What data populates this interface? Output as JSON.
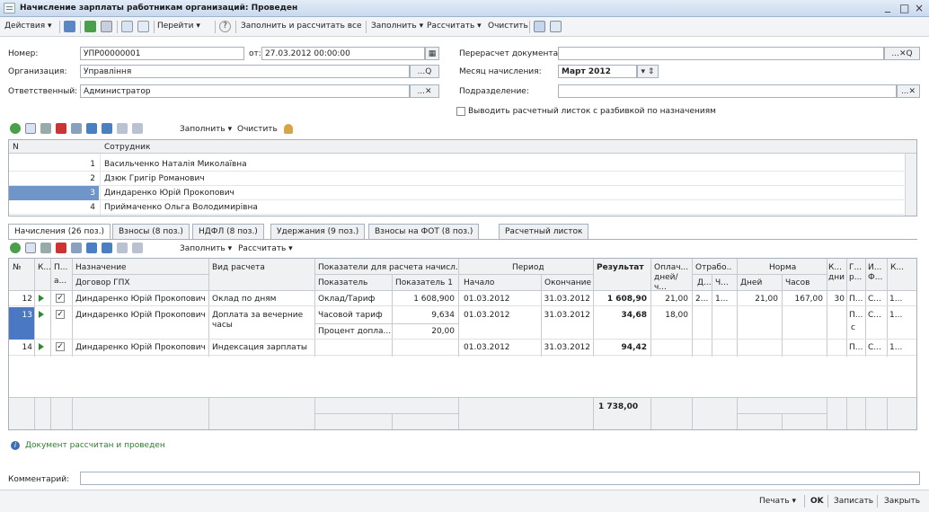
{
  "window": {
    "title": "Начисление зарплаты работникам организаций: Проведен",
    "minimize": "_",
    "maximize": "□",
    "close": "×"
  },
  "toolbar": {
    "actions": "Действия ▾",
    "goto": "Перейти ▾",
    "fill_calc_all": "Заполнить и рассчитать все",
    "fill": "Заполнить ▾",
    "calc": "Рассчитать ▾",
    "clear": "Очистить"
  },
  "header": {
    "number_label": "Номер:",
    "number_value": "УПР00000001",
    "date_label": "от:",
    "date_value": "27.03.2012 00:00:00",
    "org_label": "Организация:",
    "org_value": "Управління",
    "resp_label": "Ответственный:",
    "resp_value": "Администратор",
    "recalc_label": "Перерасчет документа:",
    "recalc_value": "",
    "month_label": "Месяц начисления:",
    "month_value": "Март 2012",
    "dept_label": "Подразделение:",
    "dept_value": "",
    "payslip_checkbox": "Выводить расчетный листок с разбивкой по назначениям"
  },
  "emp_toolbar": {
    "fill": "Заполнить ▾",
    "clear": "Очистить"
  },
  "employees": {
    "col_n": "N",
    "col_name": "Сотрудник",
    "rows": [
      {
        "n": "1",
        "name": "Васильченко Наталія Миколаївна"
      },
      {
        "n": "2",
        "name": "Дзюк Григір Романович"
      },
      {
        "n": "3",
        "name": "Диндаренко Юрій Прокопович"
      },
      {
        "n": "4",
        "name": "Приймаченко Ольга Володимирівна"
      }
    ]
  },
  "tabs": [
    {
      "label": "Начисления (26 поз.)"
    },
    {
      "label": "Взносы (8 поз.)"
    },
    {
      "label": "НДФЛ (8 поз.)"
    },
    {
      "label": "Удержания (9 поз.)"
    },
    {
      "label": "Взносы на ФОТ (8 поз.)"
    },
    {
      "label": "Расчетный листок"
    }
  ],
  "acc_toolbar": {
    "fill": "Заполнить ▾",
    "calc": "Рассчитать ▾"
  },
  "accruals": {
    "h_no": "№",
    "h_k": "К...",
    "h_p": "П...",
    "h_a": "а...",
    "h_assign": "Назначение",
    "h_contract": "Договор ГПХ",
    "h_calc_type": "Вид расчета",
    "h_indicators": "Показатели для расчета начисл...",
    "h_indicator": "Показатель",
    "h_indicator1": "Показатель 1",
    "h_period": "Период",
    "h_start": "Начало",
    "h_end": "Окончание",
    "h_result": "Результат",
    "h_paid": "Оплач... дней/ч...",
    "h_worked": "Отрабо...",
    "h_d": "Д...",
    "h_ch": "Ч...",
    "h_norm": "Норма",
    "h_days": "Дней",
    "h_hours": "Часов",
    "h_kdni": "К... дни",
    "h_g": "Г... р...",
    "h_i": "И... Ф...",
    "h_kk": "К...",
    "rows": [
      {
        "no": "12",
        "assign": "Диндаренко Юрій Прокопович",
        "calc_type": "Оклад по дням",
        "indicator": "Оклад/Тариф",
        "ind1": "1 608,900",
        "start": "01.03.2012",
        "end": "31.03.2012",
        "result": "1 608,90",
        "paid": "21,00",
        "wd": "2...",
        "wh": "1...",
        "ndays": "21,00",
        "nhours": "167,00",
        "kd": "30",
        "g": "П...",
        "i": "С...",
        "k": "1..."
      },
      {
        "no": "13",
        "assign": "Диндаренко Юрій Прокопович",
        "calc_type": "Доплата за вечерние часы",
        "indicator": "Часовой тариф",
        "ind1": "9,634",
        "indicator2": "Процент допла...",
        "ind2": "20,00",
        "start": "01.03.2012",
        "end": "31.03.2012",
        "result": "34,68",
        "paid": "18,00",
        "g": "П...",
        "g2": "с",
        "i": "С...",
        "k": "1..."
      },
      {
        "no": "14",
        "assign": "Диндаренко Юрій Прокопович",
        "calc_type": "Индексация зарплаты",
        "indicator": "",
        "ind1": "",
        "start": "01.03.2012",
        "end": "31.03.2012",
        "result": "94,42",
        "g": "П...",
        "i": "С...",
        "k": "1..."
      }
    ],
    "total": "1 738,00"
  },
  "status_message": "Документ рассчитан и проведен",
  "comment_label": "Комментарий:",
  "comment_value": "",
  "bottom": {
    "print": "Печать ▾",
    "ok": "OK",
    "save": "Записать",
    "close": "Закрыть"
  }
}
